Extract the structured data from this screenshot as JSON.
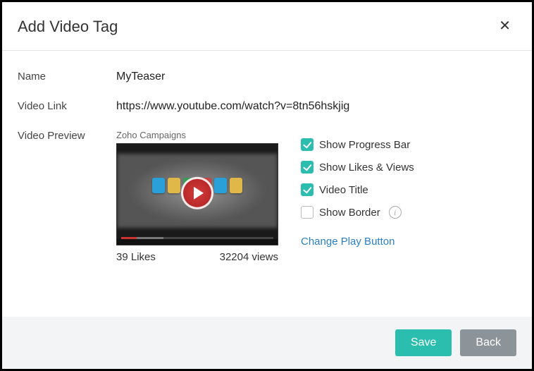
{
  "dialog": {
    "title": "Add Video Tag"
  },
  "fields": {
    "name_label": "Name",
    "name_value": "MyTeaser",
    "link_label": "Video Link",
    "link_value": "https://www.youtube.com/watch?v=8tn56hskjig",
    "preview_label": "Video Preview"
  },
  "preview": {
    "source_title": "Zoho Campaigns",
    "likes_text": "39 Likes",
    "views_text": "32204 views"
  },
  "options": {
    "progress": {
      "label": "Show Progress Bar",
      "checked": true
    },
    "likes_views": {
      "label": "Show Likes & Views",
      "checked": true
    },
    "video_title": {
      "label": "Video Title",
      "checked": true
    },
    "border": {
      "label": "Show Border",
      "checked": false
    },
    "change_play_label": "Change Play Button"
  },
  "footer": {
    "save": "Save",
    "back": "Back"
  },
  "colors": {
    "accent": "#2bbdad",
    "link": "#2b7fc1"
  }
}
